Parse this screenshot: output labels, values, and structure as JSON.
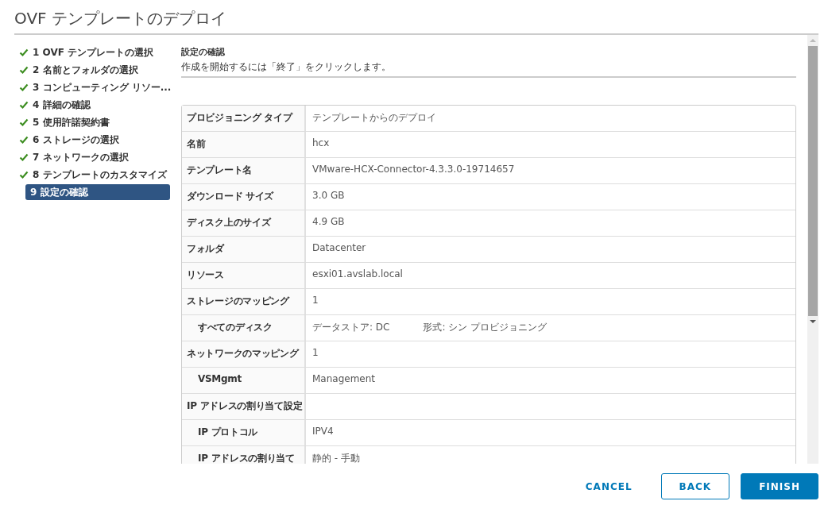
{
  "window": {
    "title": "OVF テンプレートのデプロイ"
  },
  "steps": [
    {
      "label": "1 OVF テンプレートの選択",
      "done": true,
      "selected": false
    },
    {
      "label": "2 名前とフォルダの選択",
      "done": true,
      "selected": false
    },
    {
      "label": "3 コンピューティング リソー...",
      "done": true,
      "selected": false
    },
    {
      "label": "4 詳細の確認",
      "done": true,
      "selected": false
    },
    {
      "label": "5 使用許諾契約書",
      "done": true,
      "selected": false
    },
    {
      "label": "6 ストレージの選択",
      "done": true,
      "selected": false
    },
    {
      "label": "7 ネットワークの選択",
      "done": true,
      "selected": false
    },
    {
      "label": "8 テンプレートのカスタマイズ",
      "done": true,
      "selected": false
    },
    {
      "label": "9 設定の確認",
      "done": false,
      "selected": true
    }
  ],
  "section": {
    "title": "設定の確認",
    "description": "作成を開始するには「終了」をクリックします。"
  },
  "table": {
    "rows": [
      {
        "label": "プロビジョニング タイプ",
        "values": [
          "テンプレートからのデプロイ"
        ]
      },
      {
        "label": "名前",
        "values": [
          "hcx"
        ]
      },
      {
        "label": "テンプレート名",
        "values": [
          "VMware-HCX-Connector-4.3.3.0-19714657"
        ]
      },
      {
        "label": "ダウンロード サイズ",
        "values": [
          "3.0 GB"
        ]
      },
      {
        "label": "ディスク上のサイズ",
        "values": [
          "4.9 GB"
        ]
      },
      {
        "label": "フォルダ",
        "values": [
          "Datacenter"
        ]
      },
      {
        "label": "リソース",
        "values": [
          "esxi01.avslab.local"
        ]
      },
      {
        "label": "ストレージのマッピング",
        "values": [
          "1"
        ],
        "children": [
          {
            "label": "すべてのディスク",
            "values": [
              "データストア: DC",
              "形式: シン プロビジョニング"
            ]
          }
        ]
      },
      {
        "label": "ネットワークのマッピング",
        "values": [
          "1"
        ],
        "children": [
          {
            "label": "VSMgmt",
            "values": [
              "Management"
            ]
          }
        ]
      },
      {
        "label": "IP アドレスの割り当て設定",
        "values": [],
        "children": [
          {
            "label": "IP プロトコル",
            "values": [
              "IPV4"
            ]
          },
          {
            "label": "IP アドレスの割り当て",
            "values": [
              "静的 - 手動"
            ]
          }
        ]
      }
    ]
  },
  "buttons": [
    {
      "label": "CANCEL",
      "kind": "flat"
    },
    {
      "label": "BACK",
      "kind": "outline"
    },
    {
      "label": "FINISH",
      "kind": "primary"
    }
  ]
}
